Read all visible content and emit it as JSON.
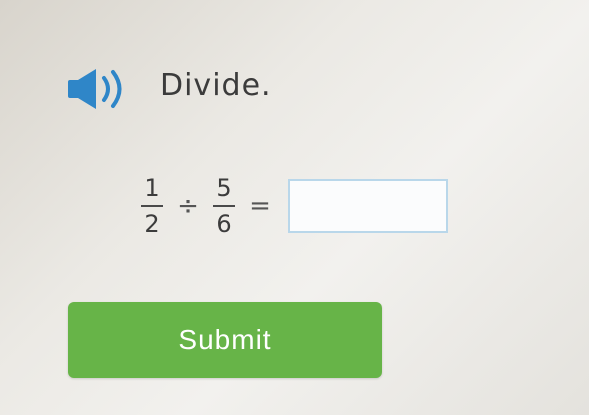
{
  "question": {
    "instruction": "Divide.",
    "audio_icon": "speaker-icon",
    "expression": {
      "first": {
        "numerator": "1",
        "denominator": "2"
      },
      "operator": "÷",
      "second": {
        "numerator": "5",
        "denominator": "6"
      },
      "equals": "="
    },
    "answer_value": ""
  },
  "submit": {
    "label": "Submit"
  },
  "colors": {
    "accent_blue": "#2f86c8",
    "submit_green": "#67b448",
    "answer_border": "#b9d7ea"
  }
}
